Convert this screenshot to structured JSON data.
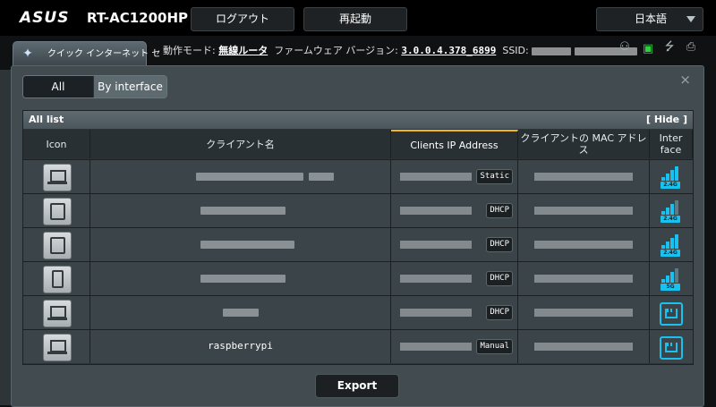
{
  "header": {
    "brand": "ASUS",
    "model": "RT-AC1200HP",
    "logout_label": "ログアウト",
    "reboot_label": "再起動",
    "language": "日本語"
  },
  "status": {
    "quick_internet_label": "クイック インターネット セ",
    "mode_label": "動作モード:",
    "mode_value": "無線ルータ",
    "firmware_label": "ファームウェア バージョン:",
    "firmware_value": "3.0.0.4.378_6899",
    "ssid_label": "SSID:"
  },
  "modal": {
    "tabs": [
      "All",
      "By interface"
    ],
    "close_glyph": "×",
    "panel_title": "All list",
    "hide_label": "[ Hide ]",
    "columns": [
      "Icon",
      "クライアント名",
      "Clients IP Address",
      "クライアントの MAC アドレス",
      "Inter face"
    ],
    "export_label": "Export"
  },
  "clients": [
    {
      "device": "laptop",
      "name": "",
      "ip_type": "Static",
      "interface": "2.4G"
    },
    {
      "device": "tablet",
      "name": "",
      "ip_type": "DHCP",
      "interface": "2.4G"
    },
    {
      "device": "tablet",
      "name": "",
      "ip_type": "DHCP",
      "interface": "2.4G"
    },
    {
      "device": "phone",
      "name": "",
      "ip_type": "DHCP",
      "interface": "5G"
    },
    {
      "device": "laptop",
      "name": "",
      "ip_type": "DHCP",
      "interface": "wired"
    },
    {
      "device": "laptop",
      "name": "raspberrypi",
      "ip_type": "Manual",
      "interface": "wired"
    }
  ],
  "colors": {
    "accent_yellow": "#f3b51b",
    "wifi_cyan": "#19c1ef"
  }
}
